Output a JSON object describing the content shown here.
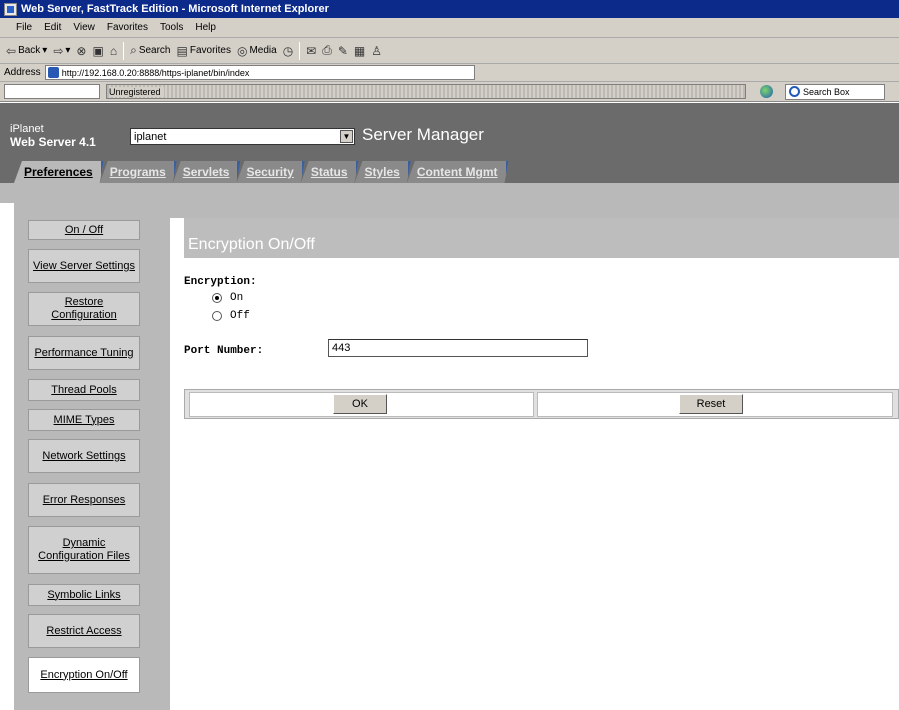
{
  "window": {
    "title": "Web Server, FastTrack Edition - Microsoft Internet Explorer"
  },
  "menu": [
    "File",
    "Edit",
    "View",
    "Favorites",
    "Tools",
    "Help"
  ],
  "toolbar": {
    "back": "Back",
    "search": "Search",
    "favorites": "Favorites",
    "media": "Media"
  },
  "address": {
    "label": "Address",
    "url": "http://192.168.0.20:8888/https-iplanet/bin/index"
  },
  "links": {
    "status": "Unregistered",
    "search_box": "Search Box"
  },
  "header": {
    "brand_top": "iPlanet",
    "brand_version": "Web Server 4.1",
    "server_selected": "iplanet",
    "title": "Server Manager",
    "tabs": [
      "Preferences",
      "Programs",
      "Servlets",
      "Security",
      "Status",
      "Styles",
      "Content Mgmt"
    ],
    "active_tab": "Preferences"
  },
  "nav": [
    "On / Off",
    "View Server Settings",
    "Restore Configuration",
    "Performance Tuning",
    "Thread Pools",
    "MIME Types",
    "Network Settings",
    "Error Responses",
    "Dynamic Configuration Files",
    "Symbolic Links",
    "Restrict Access",
    "Encryption On/Off"
  ],
  "main": {
    "title": "Encryption On/Off",
    "encryption_label": "Encryption:",
    "options": [
      "On",
      "Off"
    ],
    "selected_option": "On",
    "port_label": "Port Number:",
    "port_value": "443",
    "ok_label": "OK",
    "reset_label": "Reset"
  }
}
